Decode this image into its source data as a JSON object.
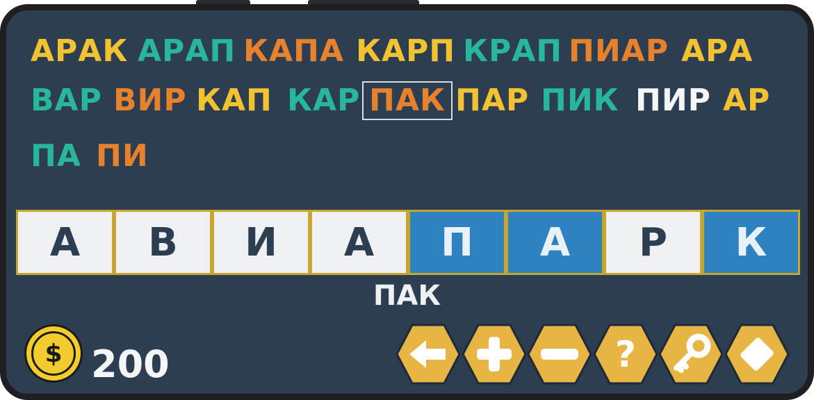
{
  "colors": {
    "yellow": "#f2c230",
    "teal": "#28b79a",
    "orange": "#e6822c",
    "white": "#f4f5f6",
    "panel": "#2d3d52",
    "tile_active": "#2e82c0",
    "tile_idle": "#eef0f2",
    "button": "#e8b544"
  },
  "found_words": [
    {
      "text": "АРАК",
      "color": "#f2c230"
    },
    {
      "text": "АРАП",
      "color": "#28b79a"
    },
    {
      "text": "КАПА",
      "color": "#e6822c"
    },
    {
      "text": "КАРП",
      "color": "#f2c230"
    },
    {
      "text": "КРАП",
      "color": "#28b79a"
    },
    {
      "text": "ПИАР",
      "color": "#e6822c"
    },
    {
      "text": "АРА",
      "color": "#f2c230"
    },
    {
      "text": "ВАР",
      "color": "#28b79a"
    },
    {
      "text": "ВИР",
      "color": "#e6822c"
    },
    {
      "text": "КАП",
      "color": "#f2c230"
    },
    {
      "text": "КАР",
      "color": "#28b79a"
    },
    {
      "text": "ПАК",
      "color": "#e6822c",
      "selected": true
    },
    {
      "text": "ПАР",
      "color": "#f2c230"
    },
    {
      "text": "ПИК",
      "color": "#28b79a"
    },
    {
      "text": "ПИР",
      "color": "#f4f5f6"
    },
    {
      "text": "АР",
      "color": "#f2c230"
    },
    {
      "text": "ПА",
      "color": "#28b79a"
    },
    {
      "text": "ПИ",
      "color": "#e6822c"
    }
  ],
  "letters": [
    {
      "char": "А",
      "active": false
    },
    {
      "char": "В",
      "active": false
    },
    {
      "char": "И",
      "active": false
    },
    {
      "char": "А",
      "active": false
    },
    {
      "char": "П",
      "active": true
    },
    {
      "char": "А",
      "active": true
    },
    {
      "char": "Р",
      "active": false
    },
    {
      "char": "К",
      "active": true
    }
  ],
  "current_word": "ПАК",
  "coins": {
    "symbol": "$",
    "count": "200"
  },
  "controls": [
    {
      "name": "back-button",
      "icon": "arrow-left-icon"
    },
    {
      "name": "zoom-in-button",
      "icon": "plus-icon"
    },
    {
      "name": "zoom-out-button",
      "icon": "minus-icon"
    },
    {
      "name": "hint-button",
      "icon": "question-icon"
    },
    {
      "name": "key-button",
      "icon": "key-icon"
    },
    {
      "name": "eraser-button",
      "icon": "eraser-icon"
    }
  ]
}
